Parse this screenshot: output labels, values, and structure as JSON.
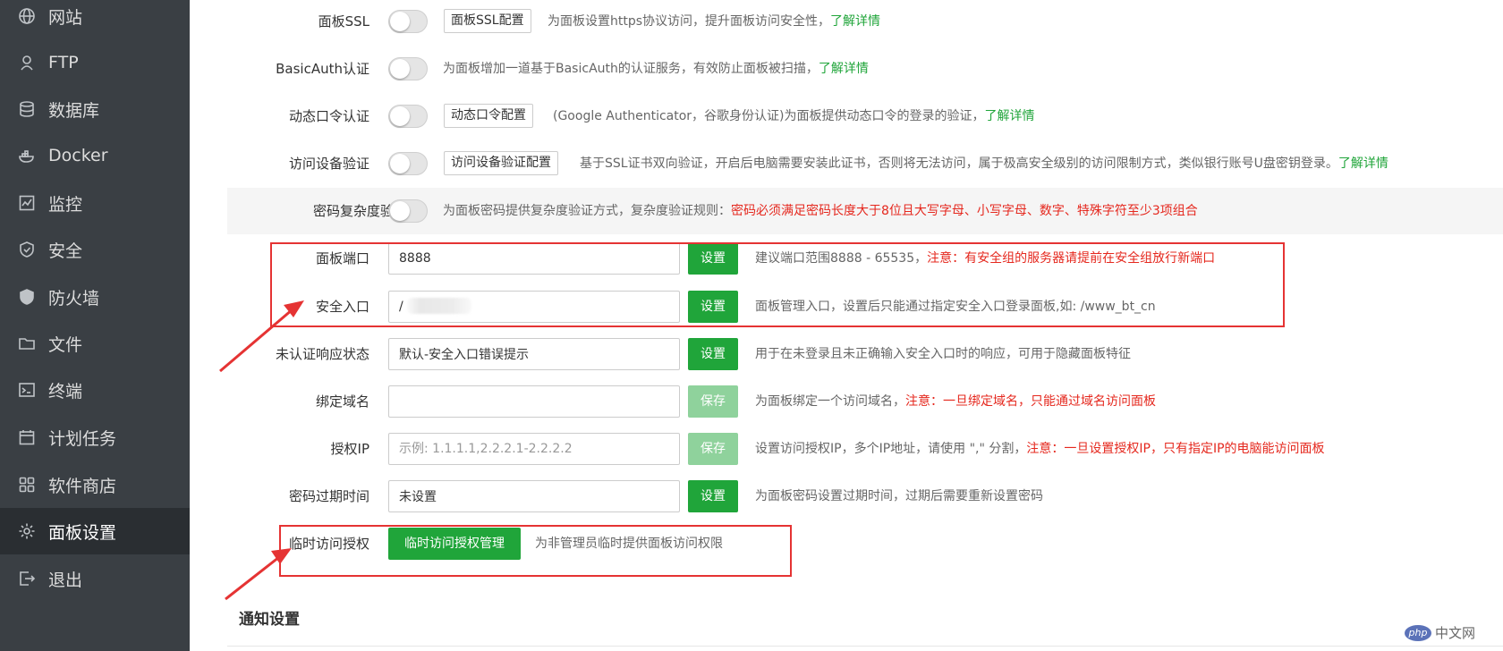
{
  "sidebar": {
    "items": [
      {
        "label": "网站",
        "icon": "globe-icon",
        "active": false
      },
      {
        "label": "FTP",
        "icon": "ftp-icon",
        "active": false
      },
      {
        "label": "数据库",
        "icon": "database-icon",
        "active": false
      },
      {
        "label": "Docker",
        "icon": "docker-icon",
        "active": false
      },
      {
        "label": "监控",
        "icon": "monitor-icon",
        "active": false
      },
      {
        "label": "安全",
        "icon": "shield-icon",
        "active": false
      },
      {
        "label": "防火墙",
        "icon": "firewall-icon",
        "active": false
      },
      {
        "label": "文件",
        "icon": "folder-icon",
        "active": false
      },
      {
        "label": "终端",
        "icon": "terminal-icon",
        "active": false
      },
      {
        "label": "计划任务",
        "icon": "calendar-icon",
        "active": false
      },
      {
        "label": "软件商店",
        "icon": "apps-icon",
        "active": false
      },
      {
        "label": "面板设置",
        "icon": "gear-icon",
        "active": true
      },
      {
        "label": "退出",
        "icon": "logout-icon",
        "active": false
      }
    ]
  },
  "toggles": [
    {
      "label": "面板SSL",
      "button": "面板SSL配置",
      "desc": "为面板设置https协议访问，提升面板访问安全性，",
      "link": "了解详情",
      "warn": "",
      "on": false
    },
    {
      "label": "BasicAuth认证",
      "button": "",
      "desc": "为面板增加一道基于BasicAuth的认证服务，有效防止面板被扫描，",
      "link": "了解详情",
      "warn": "",
      "on": false
    },
    {
      "label": "动态口令认证",
      "button": "动态口令配置",
      "desc": "(Google Authenticator，谷歌身份认证)为面板提供动态口令的登录的验证，",
      "link": "了解详情",
      "warn": "",
      "on": false
    },
    {
      "label": "访问设备验证",
      "button": "访问设备验证配置",
      "desc": "基于SSL证书双向验证，开启后电脑需要安装此证书，否则将无法访问，属于极高安全级别的访问限制方式，类似银行账号U盘密钥登录。",
      "link": "了解详情",
      "warn": "",
      "on": false
    },
    {
      "label": "密码复杂度验证",
      "button": "",
      "desc": "为面板密码提供复杂度验证方式，复杂度验证规则：",
      "link": "",
      "warn": "密码必须满足密码长度大于8位且大写字母、小写字母、数字、特殊字符至少3项组合",
      "on": false
    }
  ],
  "fields": [
    {
      "label": "面板端口",
      "value": "8888",
      "placeholder": "",
      "button": "设置",
      "button_disabled": false,
      "desc": "建议端口范围8888 - 65535，",
      "warn": "注意：有安全组的服务器请提前在安全组放行新端口"
    },
    {
      "label": "安全入口",
      "value": "/",
      "placeholder": "",
      "button": "设置",
      "button_disabled": false,
      "desc": "面板管理入口，设置后只能通过指定安全入口登录面板,如: /www_bt_cn",
      "warn": ""
    },
    {
      "label": "未认证响应状态",
      "value": "默认-安全入口错误提示",
      "placeholder": "",
      "button": "设置",
      "button_disabled": false,
      "desc": "用于在未登录且未正确输入安全入口时的响应，可用于隐藏面板特征",
      "warn": ""
    },
    {
      "label": "绑定域名",
      "value": "",
      "placeholder": "",
      "button": "保存",
      "button_disabled": true,
      "desc": "为面板绑定一个访问域名，",
      "warn": "注意：一旦绑定域名，只能通过域名访问面板"
    },
    {
      "label": "授权IP",
      "value": "",
      "placeholder": "示例: 1.1.1.1,2.2.2.1-2.2.2.2",
      "button": "保存",
      "button_disabled": true,
      "desc": "设置访问授权IP，多个IP地址，请使用 \",\" 分割，",
      "warn": "注意：一旦设置授权IP，只有指定IP的电脑能访问面板"
    },
    {
      "label": "密码过期时间",
      "value": "未设置",
      "placeholder": "",
      "button": "设置",
      "button_disabled": false,
      "desc": "为面板密码设置过期时间，过期后需要重新设置密码",
      "warn": ""
    }
  ],
  "temp_access": {
    "label": "临时访问授权",
    "button": "临时访问授权管理",
    "desc": "为非管理员临时提供面板访问权限"
  },
  "section_title": "通知设置",
  "watermark": {
    "logo": "php",
    "text": "中文网"
  },
  "colors": {
    "accent": "#20a53a",
    "warning": "#e5281e",
    "highlight_box": "#e53333",
    "sidebar_bg": "#3a3f44"
  }
}
